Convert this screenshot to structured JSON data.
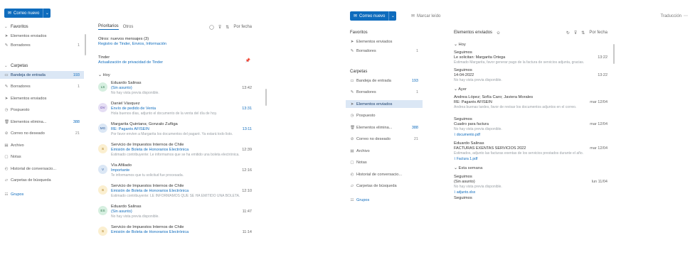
{
  "colors": {
    "accent": "#0f6cbd",
    "selected_bg": "#dbe7f5",
    "pin": "#3b6fd8"
  },
  "left": {
    "new_button_label": "Correo nuevo",
    "sidebar": {
      "favorites": "Favoritos",
      "items_fav": [
        {
          "icon": "send-icon",
          "label": "Elementos enviados",
          "count": ""
        },
        {
          "icon": "draft-icon",
          "label": "Borradores",
          "count": "1"
        }
      ],
      "folders": "Carpetas",
      "items_folders": [
        {
          "icon": "inbox-icon",
          "label": "Bandeja de entrada",
          "count": "193",
          "selected": true
        },
        {
          "icon": "draft-icon",
          "label": "Borradores",
          "count": "1"
        },
        {
          "icon": "send-icon",
          "label": "Elementos enviados",
          "count": ""
        },
        {
          "icon": "clock-icon",
          "label": "Pospuesto",
          "count": ""
        },
        {
          "icon": "trash-icon",
          "label": "Elementos elimina...",
          "count": "388"
        },
        {
          "icon": "spam-icon",
          "label": "Correo no deseado",
          "count": "21"
        },
        {
          "icon": "archive-icon",
          "label": "Archivo",
          "count": ""
        },
        {
          "icon": "note-icon",
          "label": "Notas",
          "count": ""
        },
        {
          "icon": "history-icon",
          "label": "Historial de conversacio...",
          "count": ""
        },
        {
          "icon": "folder-icon",
          "label": "Carpetas de búsqueda",
          "count": ""
        }
      ],
      "groups": "Grupos"
    },
    "list": {
      "tab_focused": "Prioritarios",
      "tab_other": "Otros",
      "filter": "Por fecha",
      "banner_title": "Otros: nuevos mensajes (3)",
      "banner_sub": "Registro de Tinder, Envios, Información",
      "pinned_from": "Tinder",
      "pinned_subj": "Actualización de privacidad de Tinder",
      "group_today": "Hoy",
      "messages": [
        {
          "initials": "LS",
          "bg": "#d6efe0",
          "fg": "#2f7a4d",
          "from": "Eduardo Salinas",
          "subj": "(Sin asunto)",
          "prev": "No hay vista previa disponible.",
          "time": "13:42",
          "blue": false
        },
        {
          "initials": "DV",
          "bg": "#e5def4",
          "fg": "#6040a8",
          "from": "Daniel Vásquez",
          "subj": "Envío de pedido de Venta",
          "prev": "Hola buenos días, adjunto el documento de la venta del día de hoy.",
          "time": "13:31",
          "blue": true
        },
        {
          "initials": "MG",
          "bg": "#dbe7f5",
          "fg": "#2a5a9a",
          "from": "Margarita Quintana; Gonzalo Zuñiga",
          "subj": "RE: Pagarés AFISEIN",
          "prev": "Por favor envíen a Margarita los documentos del pagaré. Ya estará todo listo.",
          "time": "13:11",
          "blue": true
        },
        {
          "initials": "S",
          "bg": "#fbefd0",
          "fg": "#a06a00",
          "from": "Servicio de Impuestos Internos de Chile",
          "subj": "Emisión de Boleta de Honorarios Electrónica",
          "prev": "Estimado contribuyente: Le informamos que se ha emitido una boleta electrónica.",
          "time": "12:39",
          "blue": false
        },
        {
          "initials": "V",
          "bg": "#dbe7f5",
          "fg": "#2a5a9a",
          "from": "Vía Afiliado",
          "subj": "Importante",
          "prev": "Te informamos que tu solicitud fue procesada.",
          "time": "12:16",
          "blue": false
        },
        {
          "initials": "S",
          "bg": "#fbefd0",
          "fg": "#a06a00",
          "from": "Servicio de Impuestos Internos de Chile",
          "subj": "Emisión de Boleta de Honorarios Electrónica",
          "prev": "Estimado contribuyente: LE INFORMAMOS QUE SE HA EMITIDO UNA BOLETA.",
          "time": "12:10",
          "blue": false
        },
        {
          "initials": "ES",
          "bg": "#d6efe0",
          "fg": "#2f7a4d",
          "from": "Eduardo Salinas",
          "subj": "(Sin asunto)",
          "prev": "No hay vista previa disponible.",
          "time": "11:47",
          "blue": false
        },
        {
          "initials": "S",
          "bg": "#fbefd0",
          "fg": "#a06a00",
          "from": "Servicio de Impuestos Internos de Chile",
          "subj": "Emisión de Boleta de Honorarios Electrónica",
          "prev": "",
          "time": "11:14",
          "blue": false
        }
      ]
    }
  },
  "right": {
    "new_button_label": "Correo nuevo",
    "mark_read": "Marcar leído",
    "top_right": "Traducción",
    "sidebar": {
      "favorites": "Favoritos",
      "items_fav": [
        {
          "icon": "send-icon",
          "label": "Elementos enviados",
          "count": ""
        },
        {
          "icon": "draft-icon",
          "label": "Borradores",
          "count": "1"
        }
      ],
      "folders": "Carpetas",
      "items_folders": [
        {
          "icon": "inbox-icon",
          "label": "Bandeja de entrada",
          "count": "193",
          "selected": false
        },
        {
          "icon": "draft-icon",
          "label": "Borradores",
          "count": "1",
          "selected": false
        },
        {
          "icon": "send-icon",
          "label": "Elementos enviados",
          "count": "",
          "selected": true
        },
        {
          "icon": "clock-icon",
          "label": "Pospuesto",
          "count": "",
          "selected": false
        },
        {
          "icon": "trash-icon",
          "label": "Elementos elimina...",
          "count": "388",
          "selected": false
        },
        {
          "icon": "spam-icon",
          "label": "Correo no deseado",
          "count": "21",
          "selected": false
        },
        {
          "icon": "archive-icon",
          "label": "Archivo",
          "count": "",
          "selected": false
        },
        {
          "icon": "note-icon",
          "label": "Notas",
          "count": "",
          "selected": false
        },
        {
          "icon": "history-icon",
          "label": "Historial de conversacio...",
          "count": "",
          "selected": false
        },
        {
          "icon": "folder-icon",
          "label": "Carpetas de búsqueda",
          "count": "",
          "selected": false
        }
      ],
      "groups": "Grupos"
    },
    "list": {
      "title": "Elementos enviados",
      "filter": "Por fecha",
      "groups": [
        "Hoy",
        "Ayer",
        "Esta semana"
      ],
      "messages": [
        {
          "to": "Seguimos",
          "subj": "Le solicitan: Margarita Ortega",
          "prev": "Estimado Margarita, favor generar pago de la factura de servicios adjunta, gracias.",
          "time": "13:22",
          "chip": ""
        },
        {
          "to": "Seguimos",
          "subj": "14-04-2022",
          "prev": "No hay vista previa disponible.",
          "time": "13:22",
          "chip": ""
        },
        {
          "to": "Andrea López; Sofía Caro; Javiera Morales",
          "subj": "RE: Pagarés AFISEIN",
          "prev": "Andrea buenas tardes, favor de revisar los documentos adjuntos en el correo.",
          "time": "mar 12/04",
          "chip": ""
        },
        {
          "to": "Seguimos",
          "subj": "Cuadro para factura",
          "prev": "No hay vista previa disponible.",
          "time": "mar 12/04",
          "chip": "documento.pdf"
        },
        {
          "to": "Eduardo Salinas",
          "subj": "FACTURAS EXENTAS SERVICIOS 2022",
          "prev": "Estimados, adjunto las facturas exentas de los servicios prestados durante el año.",
          "time": "mar 12/04",
          "chip": "Factura 1.pdf"
        },
        {
          "to": "Seguimos",
          "subj": "(Sin asunto)",
          "prev": "No hay vista previa disponible.",
          "time": "lun 11/04",
          "chip": "adjunto.xlsx"
        },
        {
          "to": "Seguimos",
          "subj": "",
          "prev": "",
          "time": "",
          "chip": ""
        }
      ]
    }
  }
}
